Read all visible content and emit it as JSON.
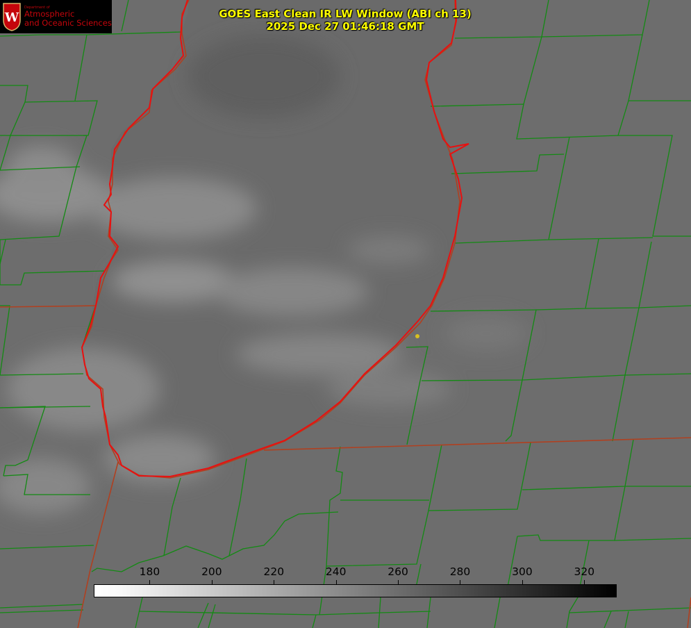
{
  "title": {
    "line1": "GOES East Clean IR LW Window (ABI ch 13)",
    "line2": "2025 Dec 27 01:46:18 GMT"
  },
  "logo": {
    "dept": "Department of",
    "line1": "Atmospheric",
    "line2": "and Oceanic Sciences",
    "crest_letter": "W"
  },
  "colorbar": {
    "ticks": [
      "180",
      "200",
      "220",
      "240",
      "260",
      "280",
      "300",
      "320"
    ],
    "min": 162,
    "max": 330,
    "colormap": "grayscale reversed (white = cold, black = warm)"
  },
  "colors": {
    "county_lines": "#138a13",
    "state_boundary": "#b04020",
    "coastline": "#e81010",
    "marker": "#d8c020",
    "title_text": "#ffff00"
  }
}
